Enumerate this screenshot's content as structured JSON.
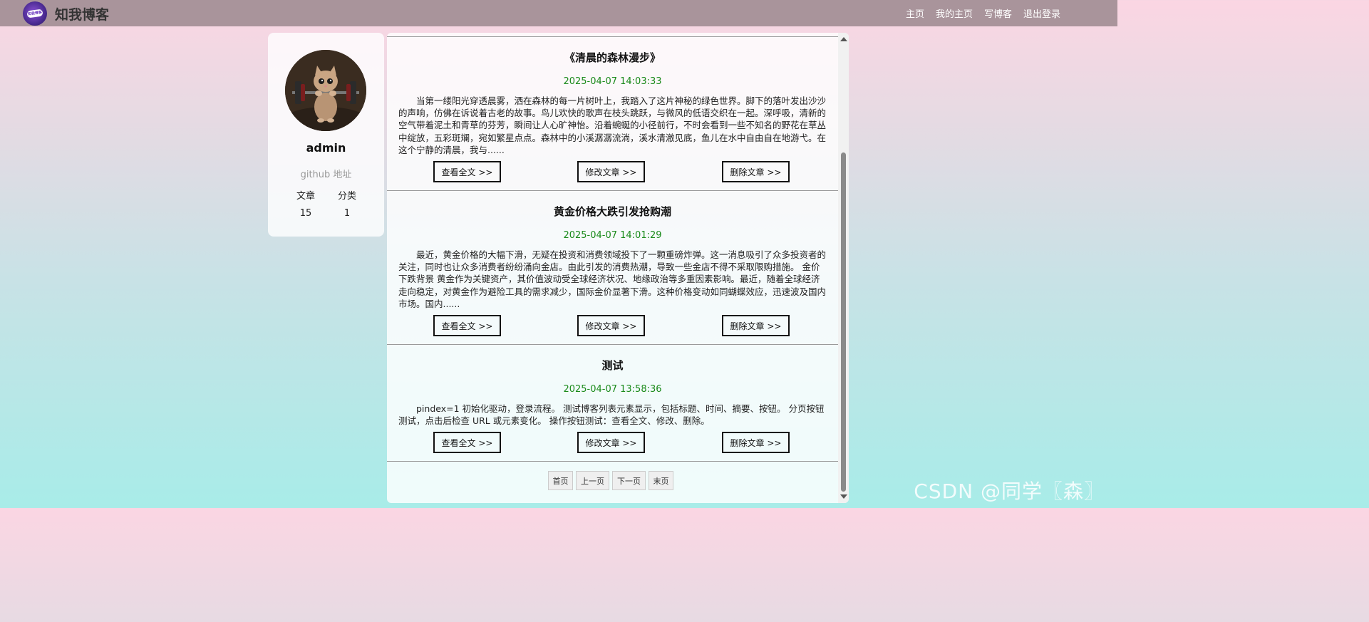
{
  "header": {
    "brand": "知我博客",
    "logo_text": "知我博客",
    "nav": [
      "主页",
      "我的主页",
      "写博客",
      "退出登录"
    ]
  },
  "profile": {
    "username": "admin",
    "github": "github 地址",
    "stats": [
      {
        "label": "文章",
        "value": "15"
      },
      {
        "label": "分类",
        "value": "1"
      }
    ]
  },
  "articles": [
    {
      "title": "《清晨的森林漫步》",
      "date": "2025-04-07 14:03:33",
      "desc": "当第一缕阳光穿透晨雾，洒在森林的每一片树叶上，我踏入了这片神秘的绿色世界。脚下的落叶发出沙沙的声响，仿佛在诉说着古老的故事。鸟儿欢快的歌声在枝头跳跃，与微风的低语交织在一起。深呼吸，清新的空气带着泥土和青草的芬芳，瞬间让人心旷神怡。沿着蜿蜒的小径前行，不时会看到一些不知名的野花在草丛中绽放，五彩斑斓，宛如繁星点点。森林中的小溪潺潺流淌，溪水清澈见底，鱼儿在水中自由自在地游弋。在这个宁静的清晨，我与......",
      "buttons": [
        "查看全文 >>",
        "修改文章 >>",
        "删除文章 >>"
      ]
    },
    {
      "title": "黄金价格大跌引发抢购潮",
      "date": "2025-04-07 14:01:29",
      "desc": "最近，黄金价格的大幅下滑，无疑在投资和消费领域投下了一颗重磅炸弹。这一消息吸引了众多投资者的关注，同时也让众多消费者纷纷涌向金店。由此引发的消费热潮，导致一些金店不得不采取限购措施。 金价下跌背景 黄金作为关键资产，其价值波动受全球经济状况、地缘政治等多重因素影响。最近，随着全球经济走向稳定，对黄金作为避险工具的需求减少，国际金价显著下滑。这种价格变动如同蝴蝶效应，迅速波及国内市场。国内......",
      "buttons": [
        "查看全文 >>",
        "修改文章 >>",
        "删除文章 >>"
      ]
    },
    {
      "title": "测试",
      "date": "2025-04-07 13:58:36",
      "desc": "pindex=1 初始化驱动，登录流程。 测试博客列表元素显示，包括标题、时间、摘要、按钮。 分页按钮测试，点击后检查 URL 或元素变化。 操作按钮测试：查看全文、修改、删除。",
      "buttons": [
        "查看全文 >>",
        "修改文章 >>",
        "删除文章 >>"
      ]
    }
  ],
  "pagination": [
    "首页",
    "上一页",
    "下一页",
    "末页"
  ],
  "watermark": "CSDN @同学〖森〗",
  "colors": {
    "nav_bg": "#a9949b",
    "date_green": "#1a8a1a"
  }
}
